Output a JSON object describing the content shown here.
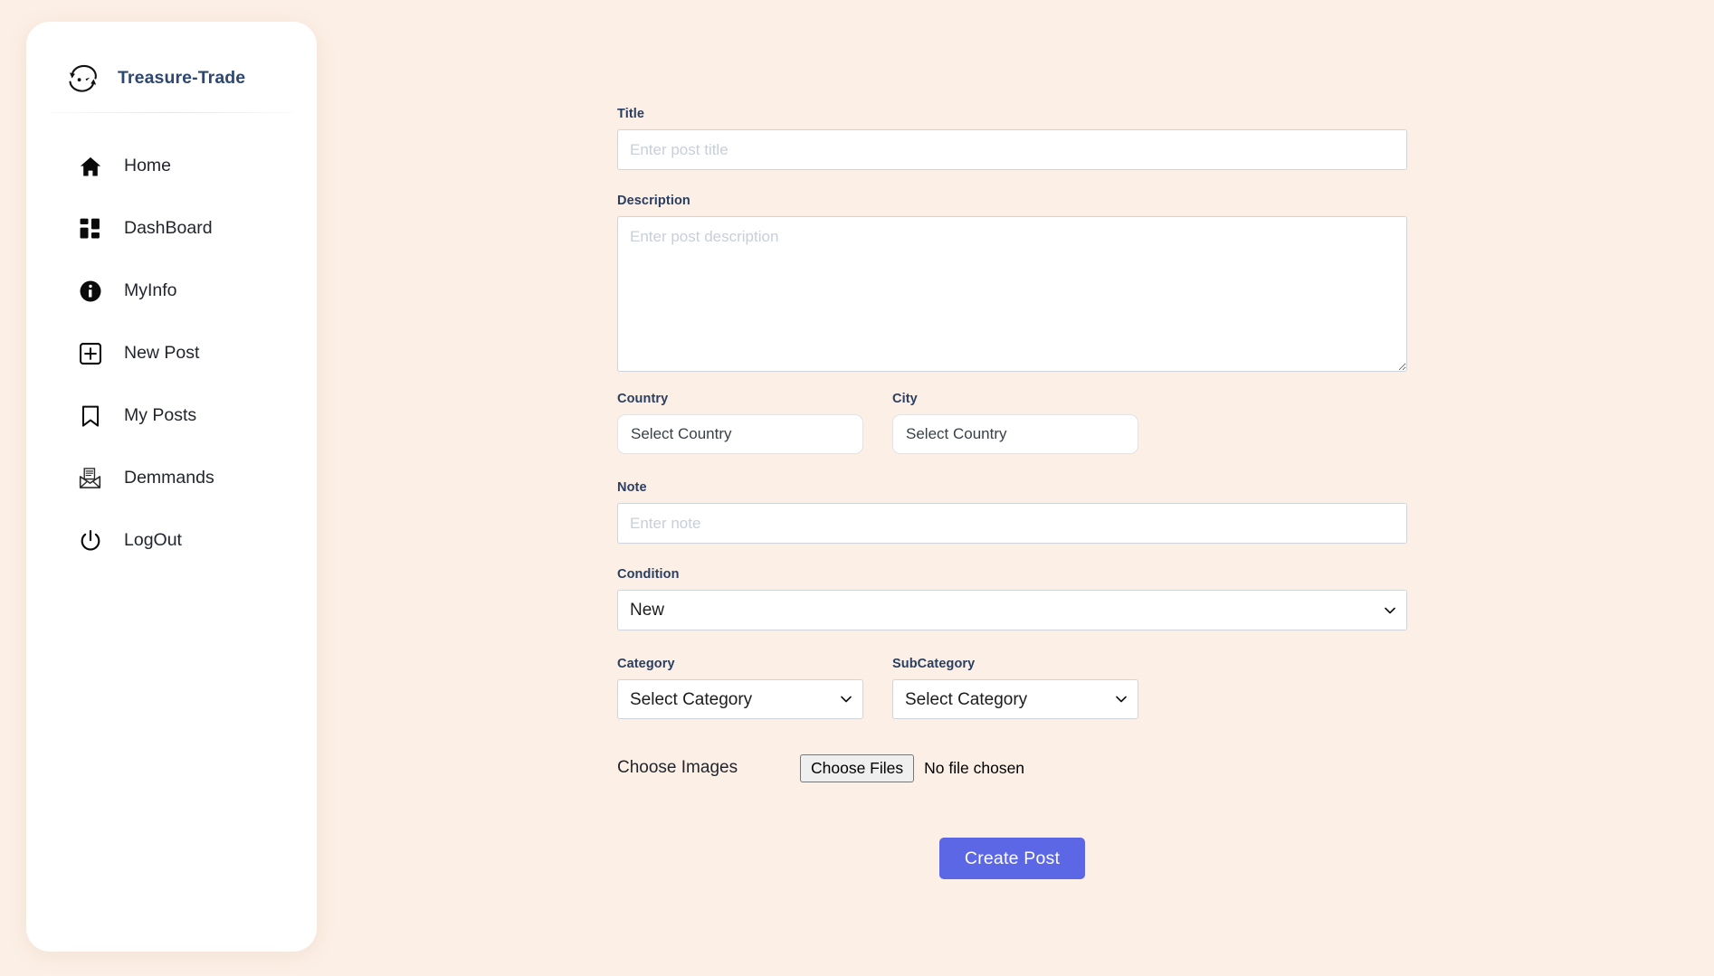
{
  "page": {
    "background_color": "#fcefe5"
  },
  "sidebar": {
    "brand": {
      "name": "Treasure-Trade",
      "icon": "swap-arrows-face-icon",
      "color": "#2e4770"
    },
    "items": [
      {
        "label": "Home",
        "icon": "home-icon"
      },
      {
        "label": "DashBoard",
        "icon": "dashboard-grid-icon"
      },
      {
        "label": "MyInfo",
        "icon": "info-circle-icon"
      },
      {
        "label": "New Post",
        "icon": "plus-square-icon"
      },
      {
        "label": "My Posts",
        "icon": "bookmark-icon"
      },
      {
        "label": "Demmands",
        "icon": "open-envelope-letter-icon"
      },
      {
        "label": "LogOut",
        "icon": "power-icon"
      }
    ]
  },
  "form": {
    "title": {
      "label": "Title",
      "placeholder": "Enter post title",
      "value": ""
    },
    "description": {
      "label": "Description",
      "placeholder": "Enter post description",
      "value": ""
    },
    "country": {
      "label": "Country",
      "placeholder": "Select Country",
      "value": ""
    },
    "city": {
      "label": "City",
      "placeholder": "Select Country",
      "value": ""
    },
    "note": {
      "label": "Note",
      "placeholder": "Enter note",
      "value": ""
    },
    "condition": {
      "label": "Condition",
      "selected": "New",
      "options": [
        "New"
      ]
    },
    "category": {
      "label": "Category",
      "selected": "Select Category",
      "options": [
        "Select Category"
      ]
    },
    "subcategory": {
      "label": "SubCategory",
      "selected": "Select Category",
      "options": [
        "Select Category"
      ]
    },
    "images": {
      "label": "Choose Images",
      "button_label": "Choose Files",
      "status": "No file chosen"
    },
    "submit": {
      "label": "Create Post",
      "color": "#5c67e5"
    }
  }
}
